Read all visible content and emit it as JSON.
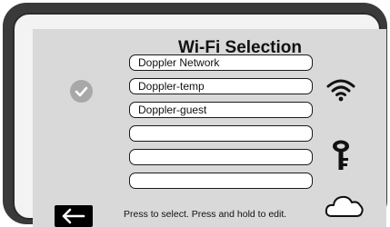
{
  "screen": {
    "title": "Wi-Fi Selection",
    "networks": [
      {
        "label": "Doppler Network",
        "selected": true
      },
      {
        "label": "Doppler-temp",
        "selected": false
      },
      {
        "label": "Doppler-guest",
        "selected": false
      },
      {
        "label": "",
        "selected": false
      },
      {
        "label": "",
        "selected": false
      },
      {
        "label": "",
        "selected": false
      }
    ],
    "hint": "Press to select. Press and hold to edit.",
    "icons": {
      "check": "check-icon",
      "wifi": "wifi-icon",
      "key": "key-icon",
      "cloud": "cloud-icon",
      "back": "back-arrow-icon"
    }
  },
  "colors": {
    "bezel": "#3a3a3a",
    "screen_bg": "#d9d9d9",
    "slot_bg": "#ffffff",
    "check_bg": "#a8a8a8"
  }
}
